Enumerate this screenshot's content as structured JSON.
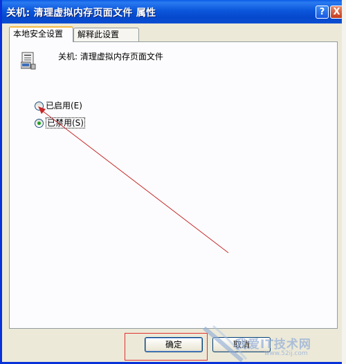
{
  "window": {
    "title": "关机: 清理虚拟内存页面文件 属性",
    "help_symbol": "?",
    "close_symbol": "X"
  },
  "tabs": [
    {
      "label": "本地安全设置",
      "active": true
    },
    {
      "label": "解释此设置",
      "active": false
    }
  ],
  "policy": {
    "icon": "policy-computer-icon",
    "name": "关机: 清理虚拟内存页面文件"
  },
  "options": [
    {
      "label": "已启用(E)",
      "checked": false
    },
    {
      "label": "已禁用(S)",
      "checked": true
    }
  ],
  "buttons": {
    "ok": "确定",
    "cancel": "取消"
  },
  "watermark": {
    "text": "我爱IT技术网",
    "sub": "www.52ij.com"
  },
  "colors": {
    "titlebar": "#0b56dc",
    "annotation": "#e03030",
    "radio_checked": "#21a121"
  }
}
